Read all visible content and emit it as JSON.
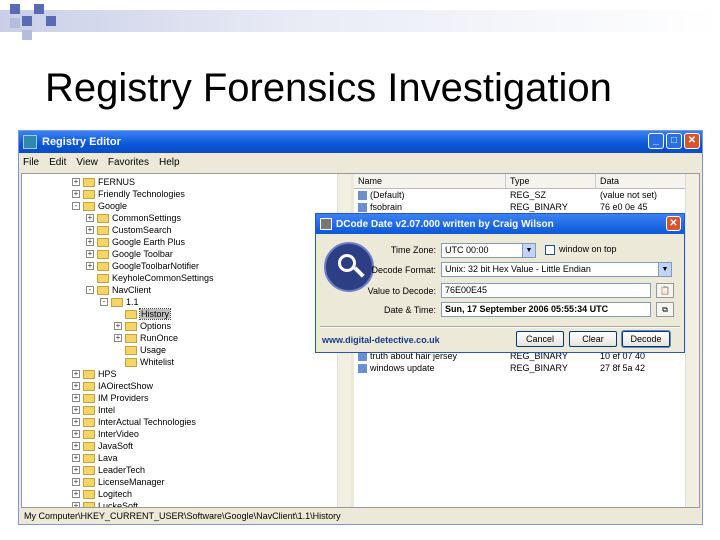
{
  "slide": {
    "title": "Registry Forensics Investigation",
    "accent_color": "#5a6bb5"
  },
  "registry_editor": {
    "window_title": "Registry Editor",
    "menu": [
      "File",
      "Edit",
      "View",
      "Favorites",
      "Help"
    ],
    "tree": [
      {
        "label": "FERNUS",
        "level": 0,
        "exp": "+"
      },
      {
        "label": "Friendly Technologies",
        "level": 0,
        "exp": "+"
      },
      {
        "label": "Google",
        "level": 0,
        "exp": "-"
      },
      {
        "label": "CommonSettings",
        "level": 1,
        "exp": "+"
      },
      {
        "label": "CustomSearch",
        "level": 1,
        "exp": "+"
      },
      {
        "label": "Google Earth Plus",
        "level": 1,
        "exp": "+"
      },
      {
        "label": "Google Toolbar",
        "level": 1,
        "exp": "+"
      },
      {
        "label": "GoogleToolbarNotifier",
        "level": 1,
        "exp": "+"
      },
      {
        "label": "KeyholeCommonSettings",
        "level": 1,
        "exp": ""
      },
      {
        "label": "NavClient",
        "level": 1,
        "exp": "-"
      },
      {
        "label": "1.1",
        "level": 2,
        "exp": "-"
      },
      {
        "label": "History",
        "level": 3,
        "exp": "",
        "selected": true
      },
      {
        "label": "Options",
        "level": 3,
        "exp": "+"
      },
      {
        "label": "RunOnce",
        "level": 3,
        "exp": "+"
      },
      {
        "label": "Usage",
        "level": 3,
        "exp": ""
      },
      {
        "label": "Whitelist",
        "level": 3,
        "exp": ""
      },
      {
        "label": "HPS",
        "level": 0,
        "exp": "+"
      },
      {
        "label": "IAOirectShow",
        "level": 0,
        "exp": "+"
      },
      {
        "label": "IM Providers",
        "level": 0,
        "exp": "+"
      },
      {
        "label": "Intel",
        "level": 0,
        "exp": "+"
      },
      {
        "label": "InterActual Technologies",
        "level": 0,
        "exp": "+"
      },
      {
        "label": "InterVideo",
        "level": 0,
        "exp": "+"
      },
      {
        "label": "JavaSoft",
        "level": 0,
        "exp": "+"
      },
      {
        "label": "Lava",
        "level": 0,
        "exp": "+"
      },
      {
        "label": "LeaderTech",
        "level": 0,
        "exp": "+"
      },
      {
        "label": "LicenseManager",
        "level": 0,
        "exp": "+"
      },
      {
        "label": "Logitech",
        "level": 0,
        "exp": "+"
      },
      {
        "label": "LuckeSoft",
        "level": 0,
        "exp": "+"
      }
    ],
    "columns": [
      "Name",
      "Type",
      "Data"
    ],
    "rows": [
      {
        "name": "(Default)",
        "type": "REG_SZ",
        "data": "(value not set)"
      },
      {
        "name": "fsobrain",
        "type": "REG_BINARY",
        "data": "76 e0 0e 45"
      },
      {
        "name": "truth about hair jersey",
        "type": "REG_BINARY",
        "data": "10 ef 07 40"
      },
      {
        "name": "windows update",
        "type": "REG_BINARY",
        "data": "27 8f 5a 42"
      }
    ],
    "status": "My Computer\\HKEY_CURRENT_USER\\Software\\Google\\NavClient\\1.1\\History"
  },
  "dcode": {
    "title": "DCode Date  v2.07.000  written by Craig Wilson",
    "time_zone_label": "Time Zone:",
    "time_zone_value": "UTC 00:00",
    "window_on_top_label": "window on top",
    "decode_format_label": "Decode Format:",
    "decode_format_value": "Unix: 32 bit Hex Value - Little Endian",
    "value_label": "Value to Decode:",
    "value": "76E00E45",
    "datetime_label": "Date & Time:",
    "datetime_value": "Sun, 17 September 2006 05:55:34  UTC",
    "url": "www.digital-detective.co.uk",
    "buttons": {
      "cancel": "Cancel",
      "clear": "Clear",
      "decode": "Decode"
    }
  }
}
